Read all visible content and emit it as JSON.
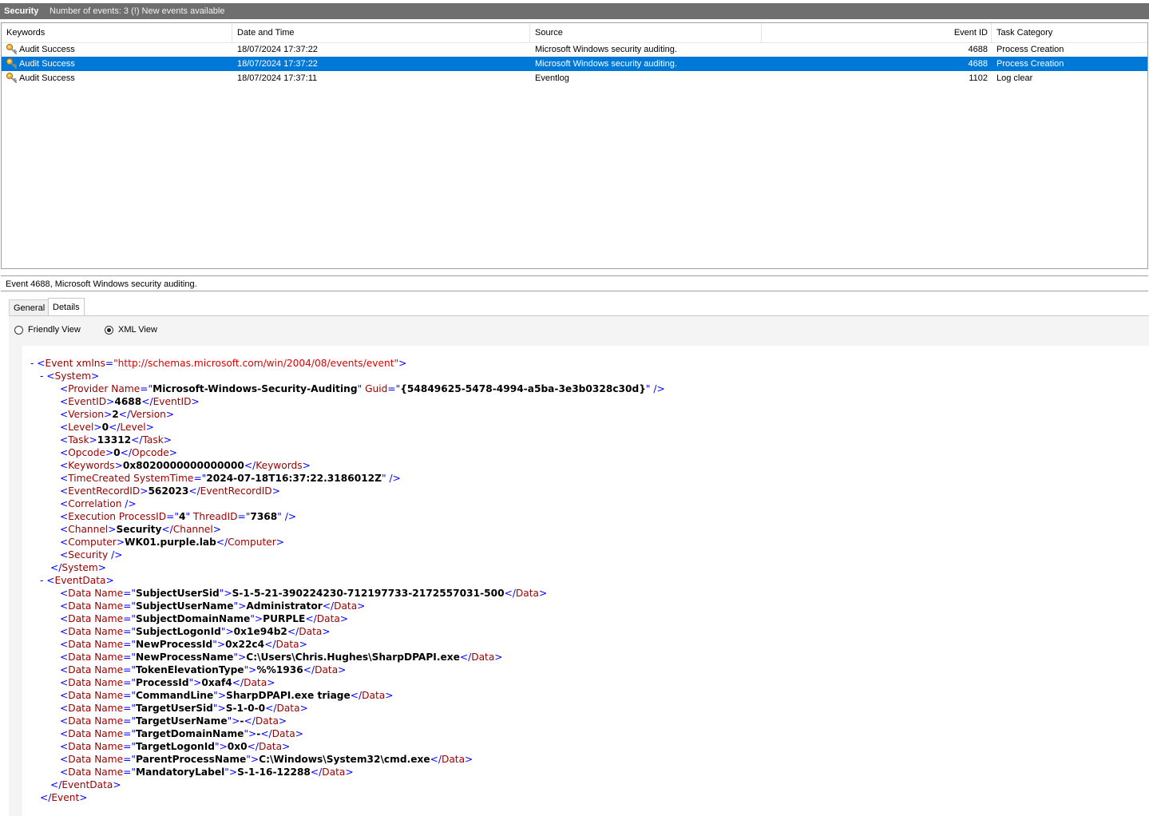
{
  "titlebar": {
    "log_name": "Security",
    "status": "Number of events: 3 (!) New events available"
  },
  "event_list": {
    "columns": {
      "keywords": "Keywords",
      "date_time": "Date and Time",
      "source": "Source",
      "event_id": "Event ID",
      "task_category": "Task Category"
    },
    "rows": [
      {
        "keywords": "Audit Success",
        "date_time": "18/07/2024 17:37:22",
        "source": "Microsoft Windows security auditing.",
        "event_id": "4688",
        "task_category": "Process Creation",
        "selected": false
      },
      {
        "keywords": "Audit Success",
        "date_time": "18/07/2024 17:37:22",
        "source": "Microsoft Windows security auditing.",
        "event_id": "4688",
        "task_category": "Process Creation",
        "selected": true
      },
      {
        "keywords": "Audit Success",
        "date_time": "18/07/2024 17:37:11",
        "source": "Eventlog",
        "event_id": "1102",
        "task_category": "Log clear",
        "selected": false
      }
    ],
    "row_icon": "key-icon",
    "selection_color": "#0078d7"
  },
  "details": {
    "title": "Event 4688, Microsoft Windows security auditing.",
    "tabs": {
      "general": "General",
      "details": "Details"
    },
    "active_tab": "Details",
    "view_options": {
      "friendly": "Friendly View",
      "xml": "XML View"
    },
    "selected_view": "XML View",
    "xml": {
      "collapse": "-",
      "event_open": "<Event xmlns=",
      "event_xmlns": "\"http://schemas.microsoft.com/win/2004/08/events/event\"",
      "event_close_bracket": ">",
      "system_open": "<System>",
      "system_close": "</System>",
      "eventdata_open": "<EventData>",
      "eventdata_close": "</EventData>",
      "event_close": "</Event>",
      "system_lines": [
        [
          "<Provider Name=\"",
          "Microsoft-Windows-Security-Auditing",
          "\" Guid=\"",
          "{54849625-5478-4994-a5ba-3e3b0328c30d}",
          "\" />"
        ],
        [
          "<EventID>",
          "4688",
          "</EventID>"
        ],
        [
          "<Version>",
          "2",
          "</Version>"
        ],
        [
          "<Level>",
          "0",
          "</Level>"
        ],
        [
          "<Task>",
          "13312",
          "</Task>"
        ],
        [
          "<Opcode>",
          "0",
          "</Opcode>"
        ],
        [
          "<Keywords>",
          "0x8020000000000000",
          "</Keywords>"
        ],
        [
          "<TimeCreated SystemTime=\"",
          "2024-07-18T16:37:22.3186012Z",
          "\" />"
        ],
        [
          "<EventRecordID>",
          "562023",
          "</EventRecordID>"
        ],
        [
          "<Correlation />"
        ],
        [
          "<Execution ProcessID=\"",
          "4",
          "\" ThreadID=\"",
          "7368",
          "\" />"
        ],
        [
          "<Channel>",
          "Security",
          "</Channel>"
        ],
        [
          "<Computer>",
          "WK01.purple.lab",
          "</Computer>"
        ],
        [
          "<Security />"
        ]
      ],
      "data_lines": [
        [
          "<Data Name=\"",
          "SubjectUserSid",
          "\">",
          "S-1-5-21-390224230-712197733-2172557031-500",
          "</Data>"
        ],
        [
          "<Data Name=\"",
          "SubjectUserName",
          "\">",
          "Administrator",
          "</Data>"
        ],
        [
          "<Data Name=\"",
          "SubjectDomainName",
          "\">",
          "PURPLE",
          "</Data>"
        ],
        [
          "<Data Name=\"",
          "SubjectLogonId",
          "\">",
          "0x1e94b2",
          "</Data>"
        ],
        [
          "<Data Name=\"",
          "NewProcessId",
          "\">",
          "0x22c4",
          "</Data>"
        ],
        [
          "<Data Name=\"",
          "NewProcessName",
          "\">",
          "C:\\Users\\Chris.Hughes\\SharpDPAPI.exe",
          "</Data>"
        ],
        [
          "<Data Name=\"",
          "TokenElevationType",
          "\">",
          "%%1936",
          "</Data>"
        ],
        [
          "<Data Name=\"",
          "ProcessId",
          "\">",
          "0xaf4",
          "</Data>"
        ],
        [
          "<Data Name=\"",
          "CommandLine",
          "\">",
          "SharpDPAPI.exe triage",
          "</Data>"
        ],
        [
          "<Data Name=\"",
          "TargetUserSid",
          "\">",
          "S-1-0-0",
          "</Data>"
        ],
        [
          "<Data Name=\"",
          "TargetUserName",
          "\">",
          "-",
          "</Data>"
        ],
        [
          "<Data Name=\"",
          "TargetDomainName",
          "\">",
          "-",
          "</Data>"
        ],
        [
          "<Data Name=\"",
          "TargetLogonId",
          "\">",
          "0x0",
          "</Data>"
        ],
        [
          "<Data Name=\"",
          "ParentProcessName",
          "\">",
          "C:\\Windows\\System32\\cmd.exe",
          "</Data>"
        ],
        [
          "<Data Name=\"",
          "MandatoryLabel",
          "\">",
          "S-1-16-12288",
          "</Data>"
        ]
      ]
    }
  }
}
